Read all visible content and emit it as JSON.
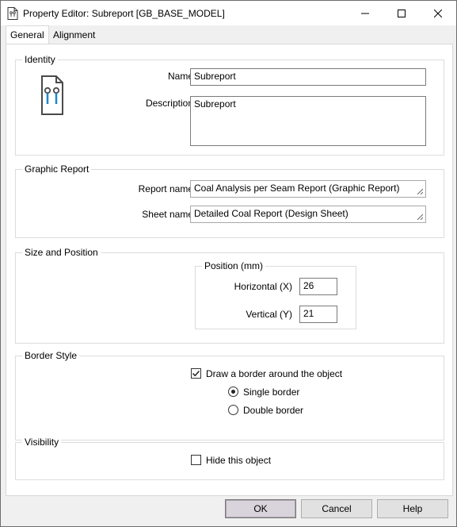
{
  "window": {
    "title": "Property Editor: Subreport [GB_BASE_MODEL]"
  },
  "tabs": [
    {
      "label": "General",
      "active": true
    },
    {
      "label": "Alignment",
      "active": false
    }
  ],
  "identity": {
    "title": "Identity",
    "name_label": "Name",
    "name_value": "Subreport",
    "description_label": "Description",
    "description_value": "Subreport"
  },
  "graphic_report": {
    "title": "Graphic Report",
    "report_name_label": "Report name",
    "report_name_value": "Coal Analysis per Seam Report (Graphic Report)",
    "sheet_name_label": "Sheet name",
    "sheet_name_value": "Detailed Coal Report (Design Sheet)"
  },
  "size_position": {
    "title": "Size and Position",
    "position_title": "Position (mm)",
    "horizontal_label": "Horizontal (X)",
    "horizontal_value": "26",
    "vertical_label": "Vertical (Y)",
    "vertical_value": "21"
  },
  "border_style": {
    "title": "Border Style",
    "draw_border_label": "Draw a border around the object",
    "draw_border_checked": true,
    "single_label": "Single border",
    "double_label": "Double border",
    "selected": "single"
  },
  "visibility": {
    "title": "Visibility",
    "hide_label": "Hide this object",
    "hide_checked": false
  },
  "buttons": {
    "ok": "OK",
    "cancel": "Cancel",
    "help": "Help"
  },
  "colors": {
    "icon_accent": "#1e88c8",
    "group_border": "#dcdcdc"
  }
}
